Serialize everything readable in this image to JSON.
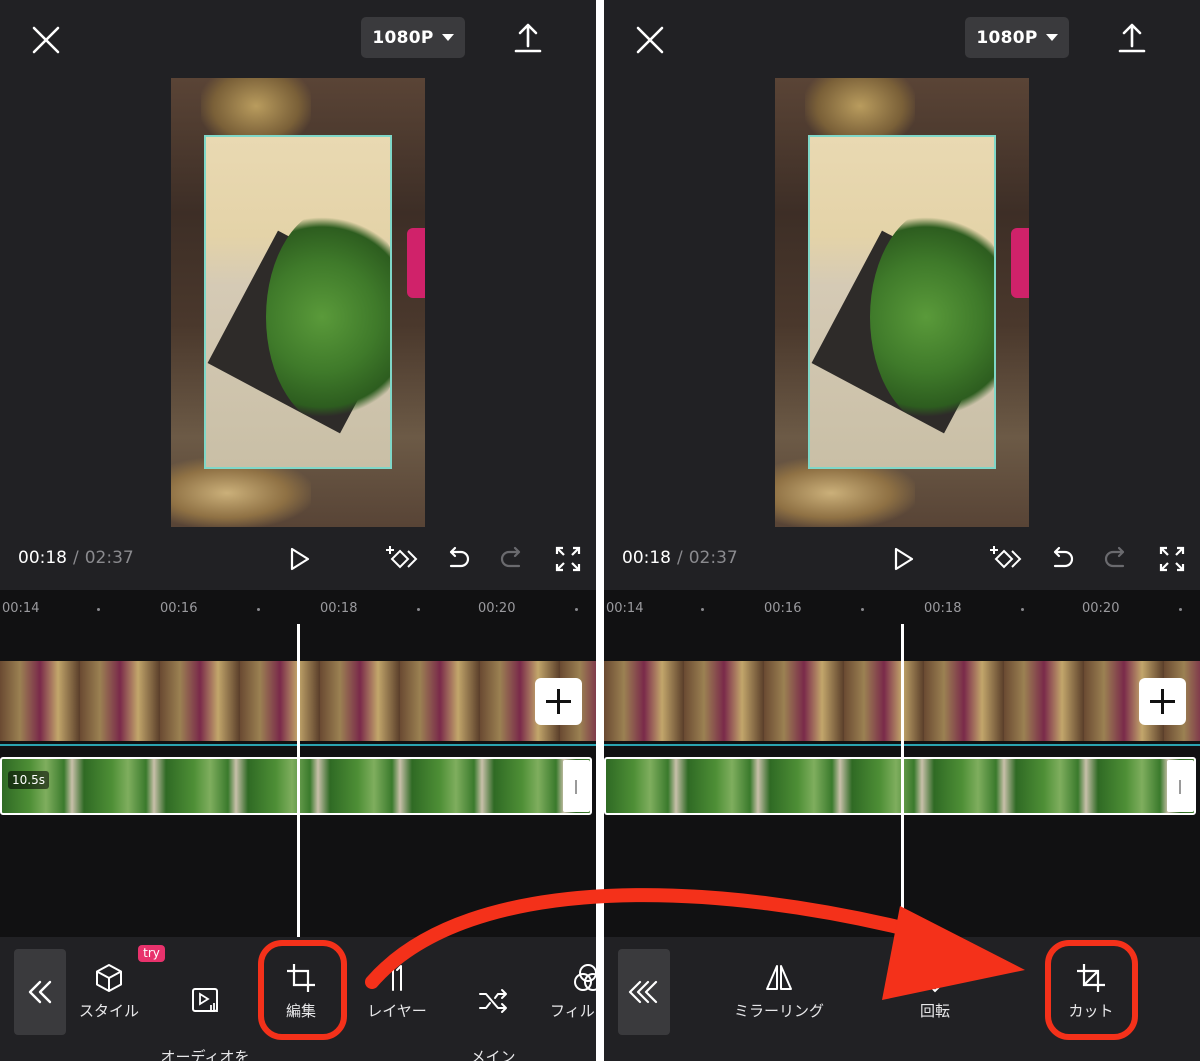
{
  "left_screen": {
    "resolution": "1080P",
    "time_current": "00:18",
    "time_separator": "/",
    "time_total": "02:37",
    "ruler_labels": [
      "00:14",
      "00:16",
      "00:18",
      "00:20"
    ],
    "layer_duration": "10.5s",
    "toolbar": {
      "try_badge": "try",
      "items": [
        {
          "label": "スタイル",
          "icon": "cube-icon"
        },
        {
          "label": "オーディオを\n抽出",
          "icon": "extract-audio-icon"
        },
        {
          "label": "編集",
          "icon": "crop-icon"
        },
        {
          "label": "レイヤー",
          "icon": "layer-icon"
        },
        {
          "label": "メイン\nトラック",
          "icon": "shuffle-icon"
        },
        {
          "label": "フィル",
          "icon": "filter-icon"
        }
      ]
    }
  },
  "right_screen": {
    "resolution": "1080P",
    "time_current": "00:18",
    "time_separator": "/",
    "time_total": "02:37",
    "ruler_labels": [
      "00:14",
      "00:16",
      "00:18",
      "00:20"
    ],
    "toolbar": {
      "items": [
        {
          "label": "ミラーリング",
          "icon": "mirror-icon"
        },
        {
          "label": "回転",
          "icon": "rotate-icon"
        },
        {
          "label": "カット",
          "icon": "crop-cut-icon"
        }
      ]
    }
  },
  "annotation": {
    "highlight_color": "#f4311a",
    "teal_accent": "#2aa3b0"
  }
}
